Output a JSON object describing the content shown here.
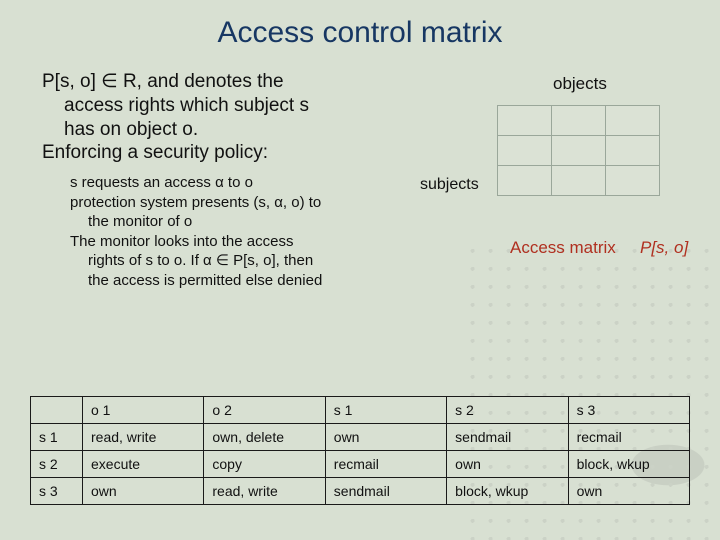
{
  "title": "Access control matrix",
  "para1_l1": "P[s, o] ∈ R, and denotes the",
  "para1_l2": "access rights which subject s",
  "para1_l3": "has on object o.",
  "para1_l4": "Enforcing a security policy:",
  "sub_l1": "s requests an access α to o",
  "sub_l2a": "protection system presents (s, α, o) to",
  "sub_l2b": "the monitor of o",
  "sub_l3a": "The monitor looks into the access",
  "sub_l3b": "rights of s to o. If α ∈ P[s, o], then",
  "sub_l3c": "the access is permitted else denied",
  "objects_label": "objects",
  "subjects_label": "subjects",
  "access_matrix_label": "Access matrix",
  "pso_label": "P[s, o]",
  "table": {
    "cols": [
      "o 1",
      "o 2",
      "s 1",
      "s 2",
      "s 3"
    ],
    "rows": [
      {
        "hdr": "s 1",
        "cells": [
          "read, write",
          "own, delete",
          "own",
          "sendmail",
          "recmail"
        ]
      },
      {
        "hdr": "s 2",
        "cells": [
          "execute",
          "copy",
          "recmail",
          "own",
          "block, wkup"
        ]
      },
      {
        "hdr": "s 3",
        "cells": [
          "own",
          "read, write",
          "sendmail",
          "block, wkup",
          "own"
        ]
      }
    ]
  }
}
